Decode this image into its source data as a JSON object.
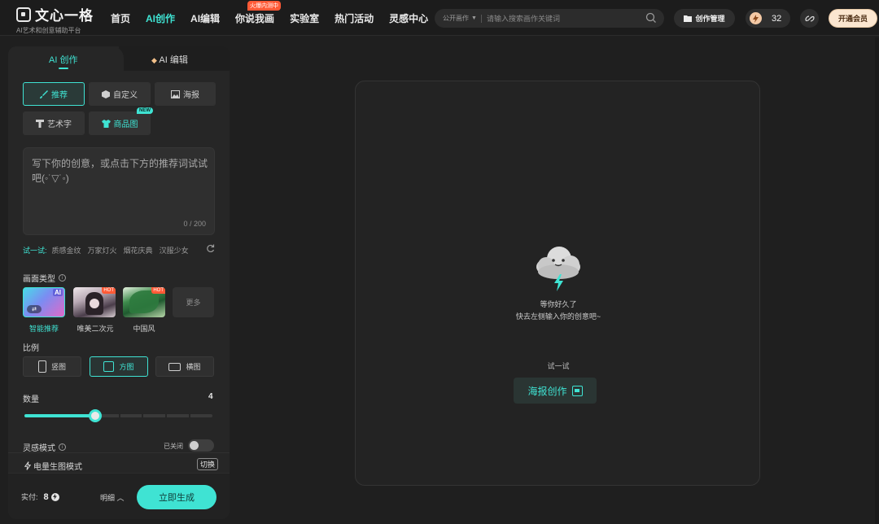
{
  "header": {
    "logo_name": "文心一格",
    "logo_sub": "AI艺术和创意辅助平台",
    "nav": [
      {
        "label": "首页",
        "active": false
      },
      {
        "label": "AI创作",
        "active": true
      },
      {
        "label": "AI编辑",
        "active": false
      },
      {
        "label": "你说我画",
        "active": false,
        "badge": "火爆内测中"
      },
      {
        "label": "实验室",
        "active": false
      },
      {
        "label": "热门活动",
        "active": false
      },
      {
        "label": "灵感中心",
        "active": false
      }
    ],
    "search_category": "公开画作",
    "search_placeholder": "请输入搜索画作关键词",
    "manage_label": "创作管理",
    "points": "32",
    "vip_label": "开通会员"
  },
  "panel": {
    "tab_create": "AI 创作",
    "tab_edit": "AI 编辑",
    "modes": [
      "推荐",
      "自定义",
      "海报",
      "艺术字",
      "商品图"
    ],
    "new_badge": "NEW",
    "prompt_placeholder": "写下你的创意，或点击下方的推荐词试试吧(◦˙▽˙◦)",
    "prompt_count": "0 / 200",
    "try_label": "试一试:",
    "try_items": [
      "质感金纹",
      "万家灯火",
      "烟花庆典",
      "汉服少女"
    ],
    "style_section": "画面类型",
    "styles": [
      {
        "label": "智能推荐",
        "tag": "AI"
      },
      {
        "label": "唯美二次元",
        "tag": "HOT"
      },
      {
        "label": "中国风",
        "tag": "HOT"
      }
    ],
    "more_label": "更多",
    "ratio_section": "比例",
    "ratios": [
      "竖图",
      "方图",
      "横图"
    ],
    "quantity_section": "数量",
    "quantity_value": "4",
    "quantity_fraction": 0.375,
    "inspiration_section": "灵感模式",
    "inspiration_status": "已关闭",
    "batch_label": "电量生图模式",
    "switch_label": "切换",
    "pay_label": "实付:",
    "pay_value": "8",
    "detail_label": "明细",
    "generate_label": "立即生成"
  },
  "canvas": {
    "empty_line1": "等你好久了",
    "empty_line2": "快去左侧输入你的创意吧~",
    "try_title": "试一试",
    "poster_label": "海报创作"
  },
  "colors": {
    "accent": "#3fe3d3",
    "hot": "#ff5a36",
    "vip": "#fbe6d0"
  }
}
